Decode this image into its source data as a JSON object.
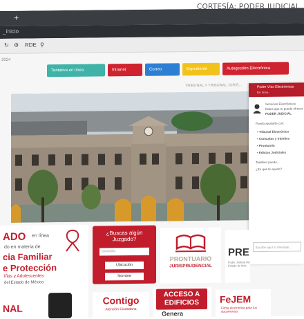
{
  "credit": "CORTESÍA: PODER JUDICIAL",
  "browser": {
    "new_tab_symbol": "+",
    "url_fragment": "_ínicio",
    "bookmark_label": "RDE"
  },
  "page": {
    "year_label": "2024",
    "nav_buttons": [
      {
        "label": "Tentativa en línea",
        "color": "#3fb3a7"
      },
      {
        "label": "Intranet",
        "color": "#cf2330"
      },
      {
        "label": "Correo",
        "color": "#2d7fd3"
      },
      {
        "label": "Expediente",
        "color": "#f1c21b"
      },
      {
        "label": "Autogestión Electrónica",
        "color": "#cf2330"
      }
    ],
    "breadcrumb": "TRIBUNAL > TRIBUNAL JURIS..."
  },
  "chat": {
    "header_title": "Poder Vías Electrónicas",
    "header_sub": "En línea",
    "lines": [
      "Servicios Electrónicos",
      "Datos que te puedo ofrecer",
      "PODER JUDICIAL",
      "Puedo ayudarte con:",
      "• Tribunal Electrónico",
      "• Consultas y trámites",
      "• Prontuario",
      "• Edictos Judiciales",
      "Tambien puedo...",
      "¿En qué te ayudo?"
    ],
    "input_placeholder": "Escribe aquí tu mensaje..."
  },
  "banners": {
    "left": {
      "line1": "ADO",
      "line1_suffix": "en línea",
      "line2": "do en materia de",
      "line3": "cia Familiar",
      "line4": "e Protección",
      "line5": "iñas y Adolescentes",
      "line6": "del Estado de México"
    },
    "search": {
      "title": "¿Buscas algún Juzgado?",
      "input_placeholder": "Domicilio",
      "button1": "Ubicación",
      "button2": "Nombre"
    },
    "prontuario": {
      "title": "PRONTUARIO",
      "subtitle": "JURISPRUDENCIAL"
    },
    "pre": {
      "title": "PRE",
      "caption": "Poder Judicial del Estado de Méx."
    },
    "bottom_left": "NAL",
    "contigo": {
      "title": "Contigo",
      "subtitle": "Atención Ciudadana"
    },
    "acceso": {
      "line1": "ACCESO A",
      "line2": "EDIFICIOS",
      "line3": "Genera"
    },
    "fejem": {
      "title": "FeJEM",
      "subtitle": "Firma electrónica para tus documentos"
    }
  },
  "colors": {
    "brand_red": "#c21d2c",
    "chat_header": "#b51d2a"
  }
}
